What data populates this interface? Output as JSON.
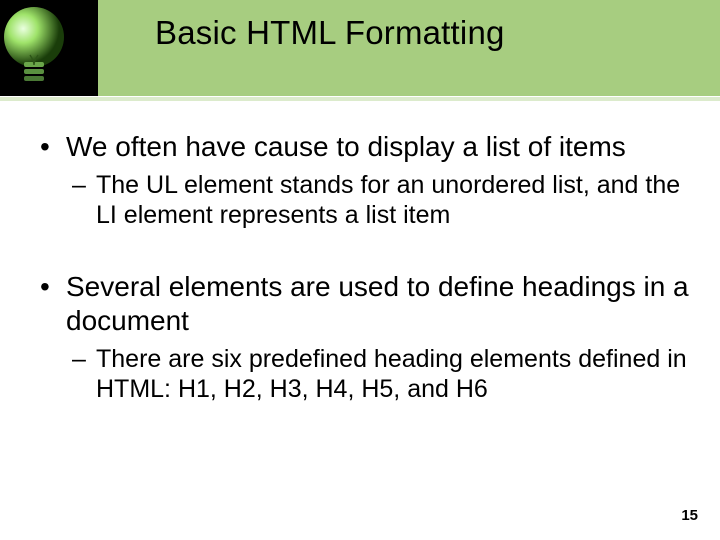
{
  "slide": {
    "title": "Basic HTML Formatting",
    "bullets": [
      {
        "text": "We often have cause to display a list of items",
        "sub": [
          "The UL element stands for an unordered list, and the LI element represents a list item"
        ]
      },
      {
        "text": "Several elements are used to define headings in a document",
        "sub": [
          "There are six predefined heading elements defined in HTML: H1, H2, H3, H4, H5, and H6"
        ]
      }
    ],
    "page_number": "15"
  }
}
